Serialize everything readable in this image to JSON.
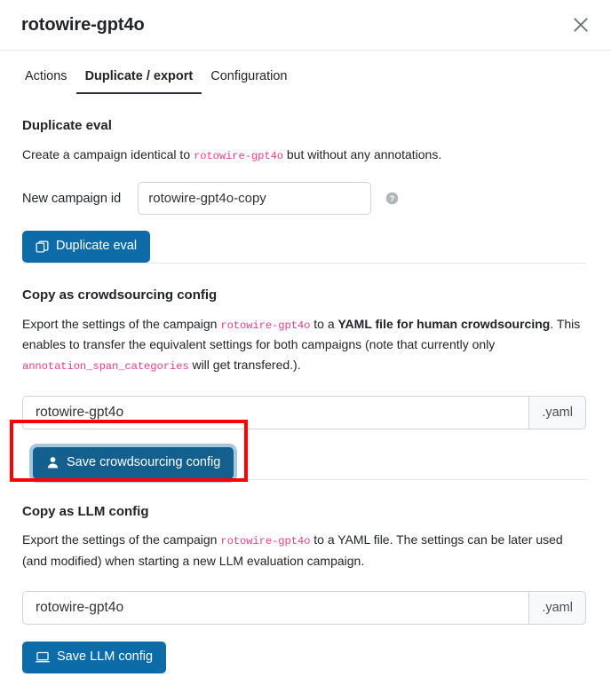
{
  "modal": {
    "title": "rotowire-gpt4o",
    "close_icon": "close-icon"
  },
  "tabs": [
    {
      "label": "Actions",
      "active": false
    },
    {
      "label": "Duplicate / export",
      "active": true
    },
    {
      "label": "Configuration",
      "active": false
    }
  ],
  "sections": {
    "duplicate": {
      "heading": "Duplicate eval",
      "desc_part1": "Create a campaign identical to ",
      "desc_code": "rotowire-gpt4o",
      "desc_part2": " but without any annotations.",
      "field_label": "New campaign id",
      "field_value": "rotowire-gpt4o-copy",
      "field_placeholder": "New campaign id",
      "help_icon": "help-circle-icon",
      "button_label": "Duplicate eval",
      "button_icon": "copy-icon"
    },
    "crowdsourcing": {
      "heading": "Copy as crowdsourcing config",
      "desc_part1": "Export the settings of the campaign ",
      "desc_code1": "rotowire-gpt4o",
      "desc_part2": " to a ",
      "desc_bold": "YAML file for human crowdsourcing",
      "desc_part3": ". This enables to transfer the equivalent settings for both campaigns (note that currently only ",
      "desc_code2": "annotation_span_categories",
      "desc_part4": " will get transfered.).",
      "filename_value": "rotowire-gpt4o",
      "filename_placeholder": "filename",
      "extension": ".yaml",
      "button_label": "Save crowdsourcing config",
      "button_icon": "person-icon"
    },
    "llm": {
      "heading": "Copy as LLM config",
      "desc_part1": "Export the settings of the campaign ",
      "desc_code": "rotowire-gpt4o",
      "desc_part2": " to a YAML file. The settings can be later used (and modified) when starting a new LLM evaluation campaign.",
      "filename_value": "rotowire-gpt4o",
      "filename_placeholder": "filename",
      "extension": ".yaml",
      "button_label": "Save LLM config",
      "button_icon": "laptop-icon"
    }
  },
  "colors": {
    "primary": "#0d6ca8",
    "focused": "#13608f",
    "code": "#e83e8c",
    "highlight": "#ff0000",
    "border": "#ced4da",
    "divider": "#e4e6e8"
  }
}
